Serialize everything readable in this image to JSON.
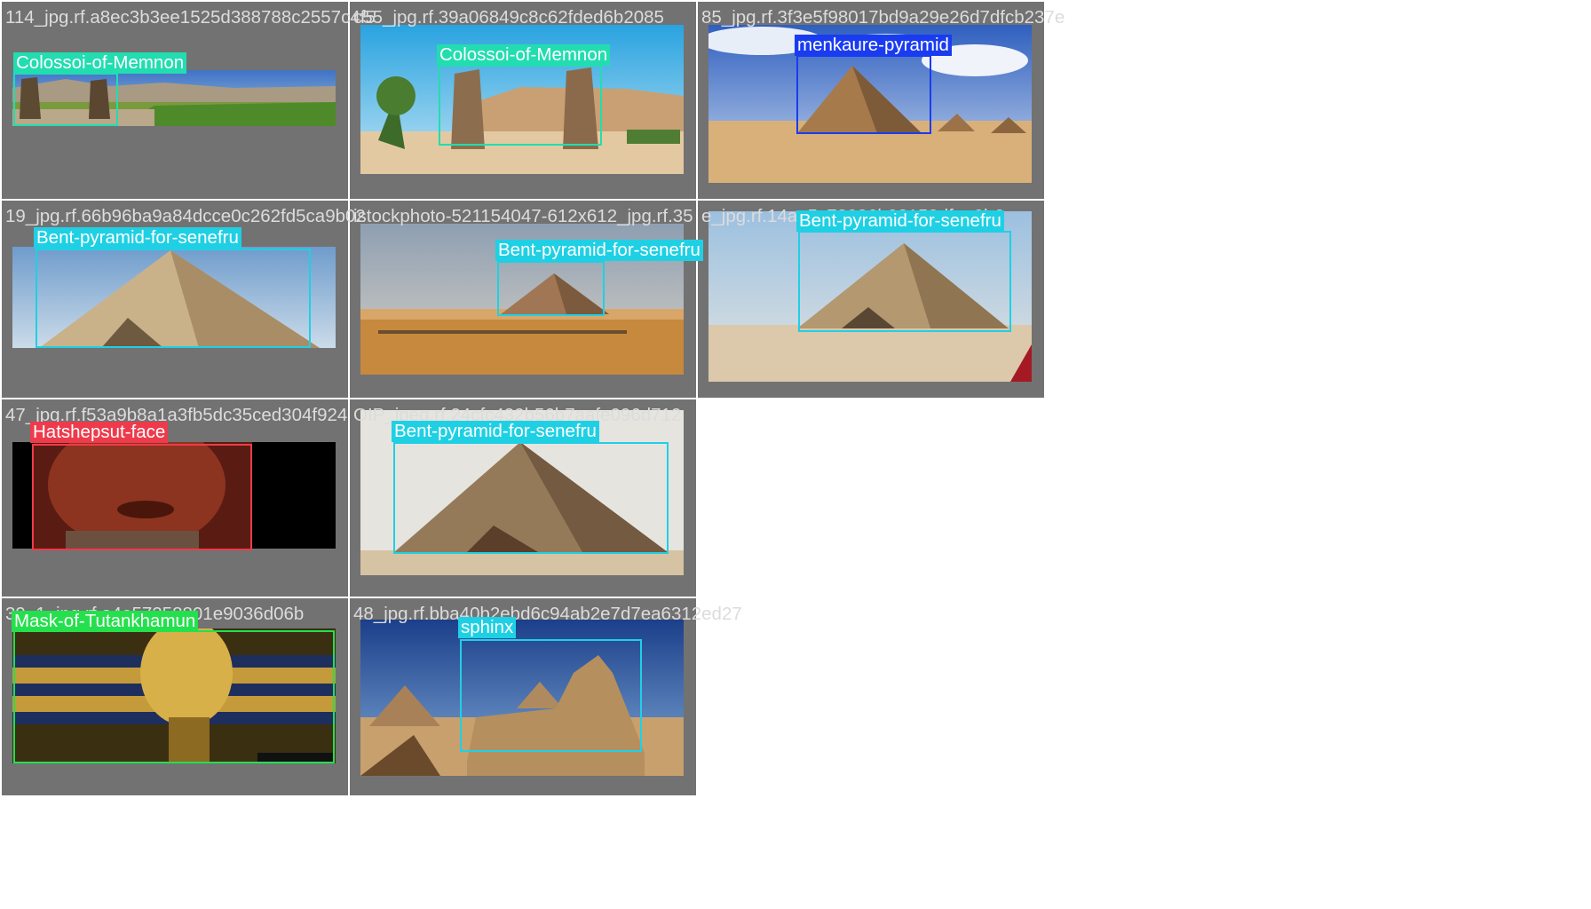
{
  "mosaic": {
    "tiles": [
      {
        "filename": "114_jpg.rf.a8ec3b3ee1525d388788c2557c4f5",
        "labels": [
          "Colossoi-of-Memnon"
        ]
      },
      {
        "filename": "c55_jpg.rf.39a06849c8c62fded6b2085",
        "labels": [
          "Colossoi-of-Memnon"
        ]
      },
      {
        "filename": "85_jpg.rf.3f3e5f98017bd9a29e26d7dfcb237e",
        "labels": [
          "menkaure-pyramid"
        ]
      },
      {
        "filename": "19_jpg.rf.66b96ba9a84dcce0c262fd5ca9b02",
        "labels": [
          "Bent-pyramid-for-senefru"
        ]
      },
      {
        "filename": "istockphoto-521154047-612x612_jpg.rf.35",
        "labels": [
          "Bent-pyramid-for-senefru"
        ]
      },
      {
        "filename": "e_jpg.rf.14aa5c78026b98158dfee0b6",
        "labels": [
          "Bent-pyramid-for-senefru"
        ]
      },
      {
        "filename": "47_jpg.rf.f53a9b8a1a3fb5dc35ced304f924",
        "labels": [
          "Hatshepsut-face"
        ]
      },
      {
        "filename": "OIP_jpeg.rf.24cfc432b56b7aafe096d712",
        "labels": [
          "Bent-pyramid-for-senefru"
        ]
      },
      {
        "filename": "39_1_jpg.rf.a4e57258801e9036d06b",
        "labels": [
          "Mask-of-Tutankhamun"
        ]
      },
      {
        "filename": "48_jpg.rf.bba40b2ebd6c94ab2e7d7ea6312ed27",
        "labels": [
          "sphinx"
        ]
      }
    ]
  },
  "colors": {
    "tile_bg": "#727272",
    "filename_text": "#dcdcdc",
    "Colossoi-of-Memnon": "#22ddb0",
    "menkaure-pyramid": "#1a3cf0",
    "Bent-pyramid-for-senefru": "#1fd0e4",
    "Hatshepsut-face": "#ee3b4b",
    "Mask-of-Tutankhamun": "#24e04c",
    "sphinx": "#1fd0e4"
  }
}
